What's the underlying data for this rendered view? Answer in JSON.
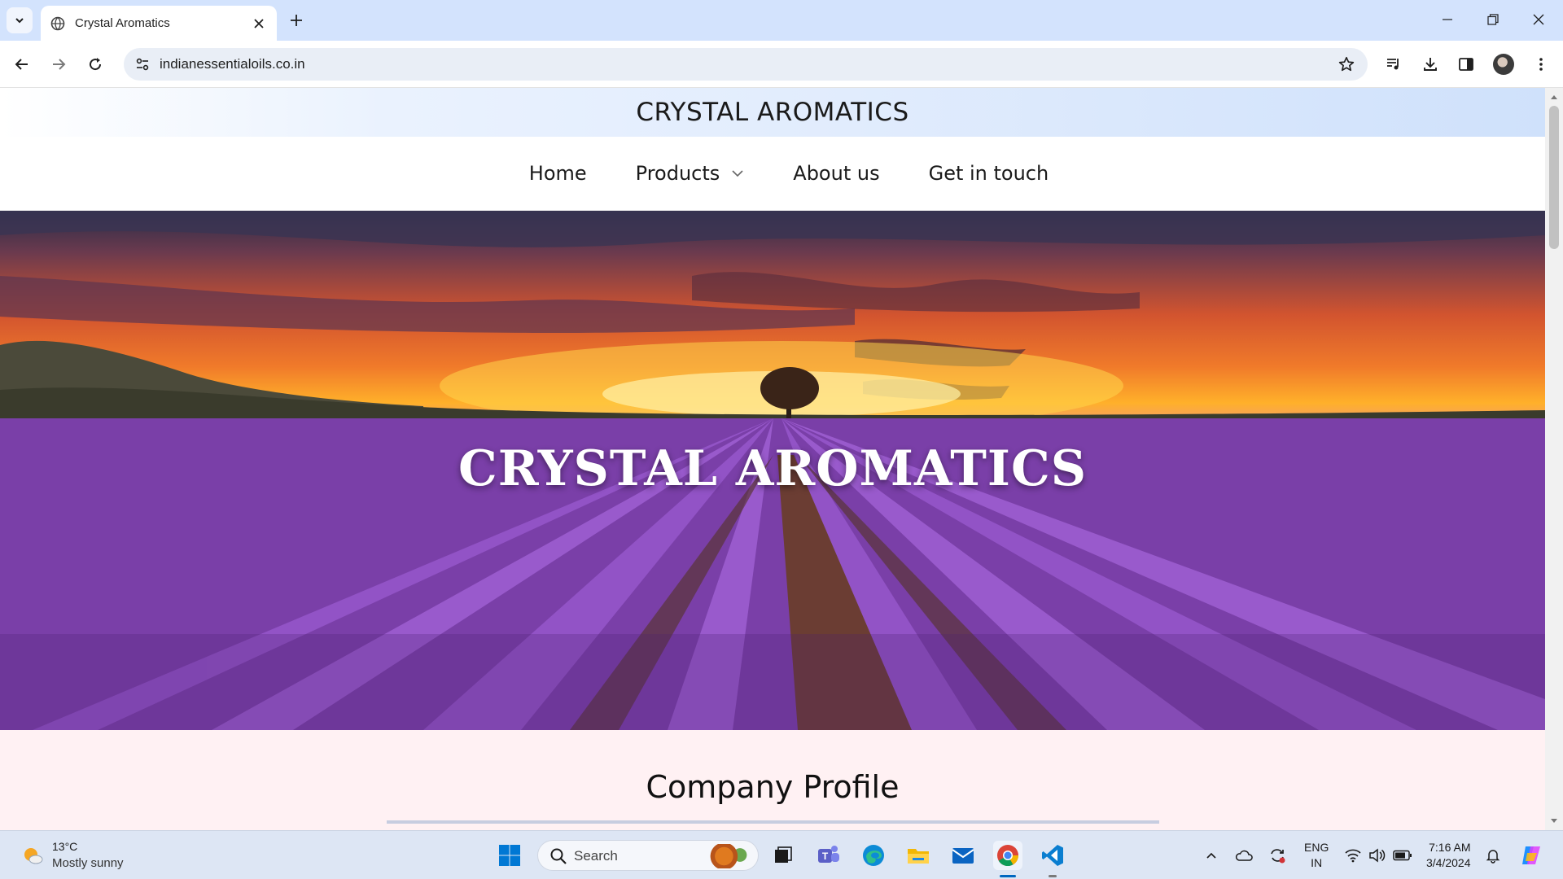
{
  "browser": {
    "tab_title": "Crystal Aromatics",
    "url": "indianessentialoils.co.in"
  },
  "site": {
    "brand": "CRYSTAL AROMATICS",
    "nav": {
      "home": "Home",
      "products": "Products",
      "about": "About us",
      "contact": "Get in touch"
    },
    "hero_title": "CRYSTAL AROMATICS",
    "section_title": "Company Profile"
  },
  "taskbar": {
    "temperature": "13°C",
    "weather": "Mostly sunny",
    "search_placeholder": "Search",
    "lang_1": "ENG",
    "lang_2": "IN",
    "time": "7:16 AM",
    "date": "3/4/2024"
  },
  "colors": {
    "tabbar_bg": "#d3e3fd",
    "taskbar_bg": "#dde6f4",
    "section_bg": "#fff1f3"
  }
}
